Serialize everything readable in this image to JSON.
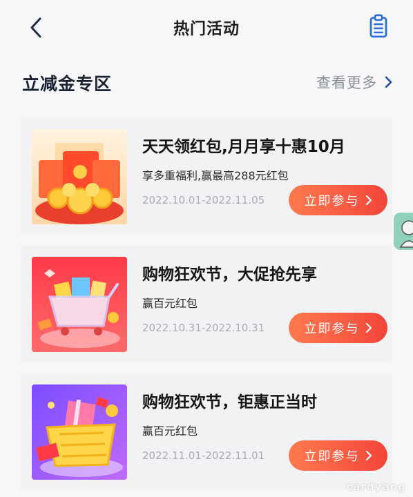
{
  "nav": {
    "title": "热门活动",
    "back_icon": "chevron-left-icon",
    "right_icon": "clipboard-icon"
  },
  "section": {
    "title": "立减金专区",
    "more_label": "查看更多",
    "more_icon": "chevron-right-icon"
  },
  "cards": [
    {
      "image_icon": "red-envelope-coins-image",
      "title": "天天领红包,月月享十惠10月",
      "subtitle": "享多重福利,赢最高288元红包",
      "date": "2022.10.01-2022.11.05",
      "button_label": "立即参与"
    },
    {
      "image_icon": "shopping-cart-image",
      "title": "购物狂欢节，大促抢先享",
      "subtitle": "赢百元红包",
      "date": "2022.10.31-2022.10.31",
      "button_label": "立即参与"
    },
    {
      "image_icon": "gift-basket-image",
      "title": "购物狂欢节，钜惠正当时",
      "subtitle": "赢百元红包",
      "date": "2022.11.01-2022.11.01",
      "button_label": "立即参与"
    }
  ],
  "watermark": "cardyang",
  "colors": {
    "accent": "#f2453a",
    "accent_light": "#ff7a4f",
    "nav_icon": "#2a6fd8",
    "card_bg": "#f2f2f4"
  }
}
